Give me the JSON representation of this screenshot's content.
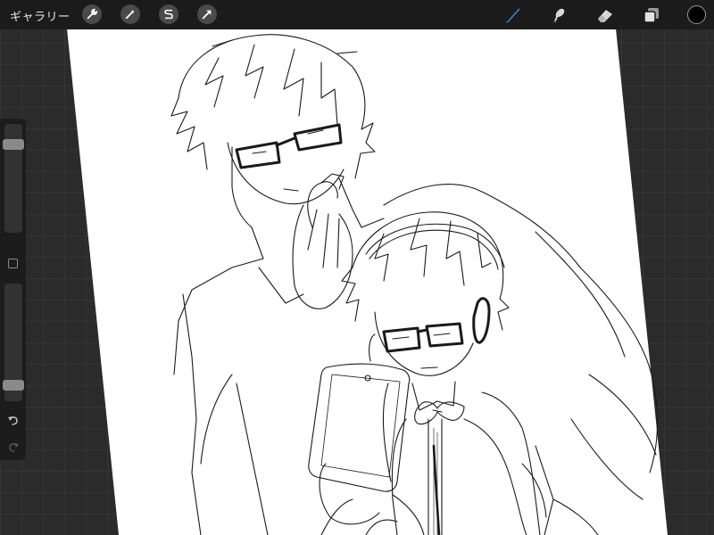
{
  "toolbar": {
    "gallery_label": "ギャラリー",
    "left_tools": [
      {
        "name": "actions",
        "icon": "wrench-icon"
      },
      {
        "name": "adjustments",
        "icon": "magic-wand-icon"
      },
      {
        "name": "selection",
        "icon": "selection-s-icon"
      },
      {
        "name": "transform",
        "icon": "arrow-cursor-icon"
      }
    ],
    "right_tools": [
      {
        "name": "brush",
        "icon": "brush-icon",
        "active": true
      },
      {
        "name": "smudge",
        "icon": "smudge-icon",
        "active": false
      },
      {
        "name": "eraser",
        "icon": "eraser-icon",
        "active": false
      },
      {
        "name": "layers",
        "icon": "layers-icon",
        "active": false
      }
    ],
    "current_color": "#000000",
    "active_color": "#3a8ee6"
  },
  "sidebar": {
    "brush_size_level": 0.85,
    "opacity_level": 0.1,
    "undo_icon": "undo-icon",
    "redo_icon": "redo-icon"
  }
}
